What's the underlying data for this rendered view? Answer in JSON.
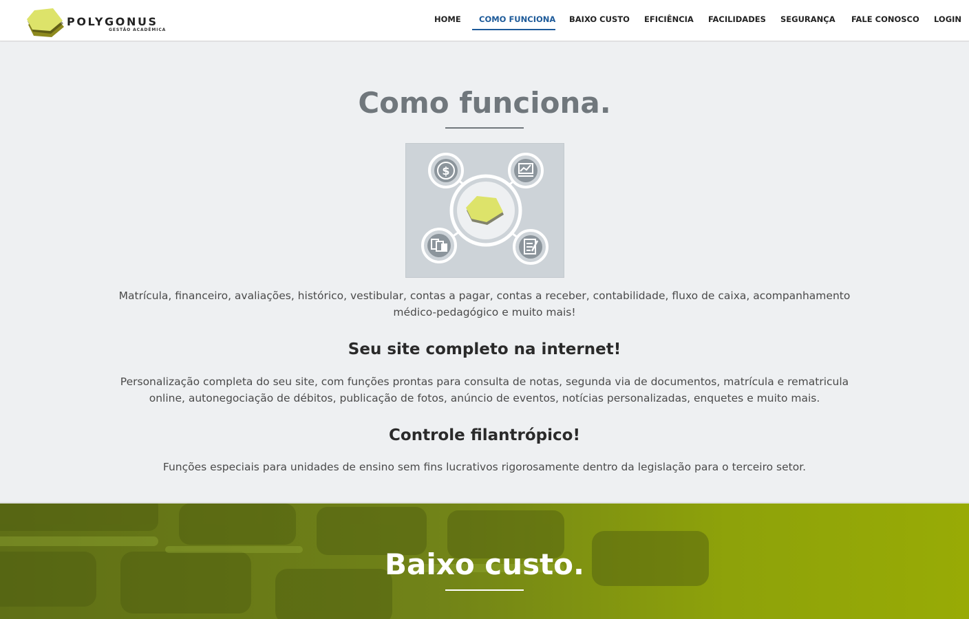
{
  "brand": {
    "name": "POLYGONUS",
    "tagline": "GESTÃO ACADÊMICA",
    "logo_color": "#dde36a"
  },
  "nav": {
    "items": [
      {
        "label": "HOME",
        "active": false
      },
      {
        "label": "COMO FUNCIONA",
        "active": true
      },
      {
        "label": "BAIXO CUSTO",
        "active": false
      },
      {
        "label": "EFICIÊNCIA",
        "active": false
      },
      {
        "label": "FACILIDADES",
        "active": false
      },
      {
        "label": "SEGURANÇA",
        "active": false
      },
      {
        "label": "FALE CONOSCO",
        "active": false
      },
      {
        "label": "LOGIN",
        "active": false
      }
    ],
    "active_color": "#1d5a99"
  },
  "como_funciona": {
    "title": "Como funciona.",
    "diagram_icons": [
      "dollar-icon",
      "chart-icon",
      "documents-icon",
      "checklist-icon"
    ],
    "intro": "Matrícula, financeiro, avaliações, histórico, vestibular, contas a pagar, contas a receber, contabilidade, fluxo de caixa, acompanhamento médico-pedagógico e muito mais!",
    "site_heading": "Seu site completo na internet!",
    "site_text": "Personalização completa do seu site, com funções prontas para consulta de notas, segunda via de documentos, matrícula e rematricula online, autonegociação de débitos, publicação de fotos, anúncio de eventos, notícias personalizadas, enquetes e muito mais.",
    "filantropico_heading": "Controle filantrópico!",
    "filantropico_text": "Funções especiais para unidades de ensino sem fins lucrativos rigorosamente dentro da legislação para o terceiro setor."
  },
  "baixo_custo": {
    "title": "Baixo custo.",
    "background_color": "#7a8c12"
  }
}
